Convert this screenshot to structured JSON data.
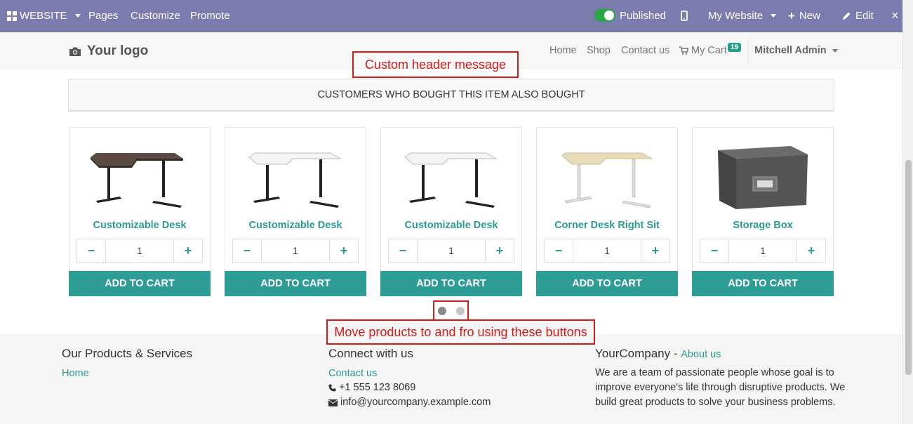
{
  "adminbar": {
    "website": "WEBSITE",
    "pages": "Pages",
    "customize": "Customize",
    "promote": "Promote",
    "published": "Published",
    "my_website": "My Website",
    "new": "New",
    "edit": "Edit",
    "color": "#7c7bad"
  },
  "header": {
    "logo": "Your logo",
    "nav": [
      "Home",
      "Shop",
      "Contact us"
    ],
    "cart": "My Cart",
    "cart_count": "19",
    "user": "Mitchell Admin"
  },
  "annotations": {
    "header_msg": "Custom header message",
    "dots_msg": "Move products to and fro using these buttons"
  },
  "section": {
    "title": "CUSTOMERS WHO BOUGHT THIS ITEM ALSO BOUGHT"
  },
  "products": [
    {
      "name": "Customizable Desk",
      "qty": "1",
      "add": "ADD TO CART",
      "image": "dark-desk"
    },
    {
      "name": "Customizable Desk",
      "qty": "1",
      "add": "ADD TO CART",
      "image": "white-desk"
    },
    {
      "name": "Customizable Desk",
      "qty": "1",
      "add": "ADD TO CART",
      "image": "white-desk"
    },
    {
      "name": "Corner Desk Right Sit",
      "qty": "1",
      "add": "ADD TO CART",
      "image": "birch-desk"
    },
    {
      "name": "Storage Box",
      "qty": "1",
      "add": "ADD TO CART",
      "image": "storage-box"
    }
  ],
  "carousel": {
    "active_index": 0,
    "count": 2
  },
  "footer": {
    "col1": {
      "title": "Our Products & Services",
      "link": "Home"
    },
    "col2": {
      "title": "Connect with us",
      "link": "Contact us",
      "phone": "+1 555 123 8069",
      "email": "info@yourcompany.example.com"
    },
    "col3": {
      "title": "YourCompany - ",
      "about": "About us",
      "text": "We are a team of passionate people whose goal is to improve everyone's life through disruptive products. We build great products to solve your business problems."
    }
  },
  "colors": {
    "accent": "#2e9d95",
    "annotation": "#d21b1b"
  }
}
